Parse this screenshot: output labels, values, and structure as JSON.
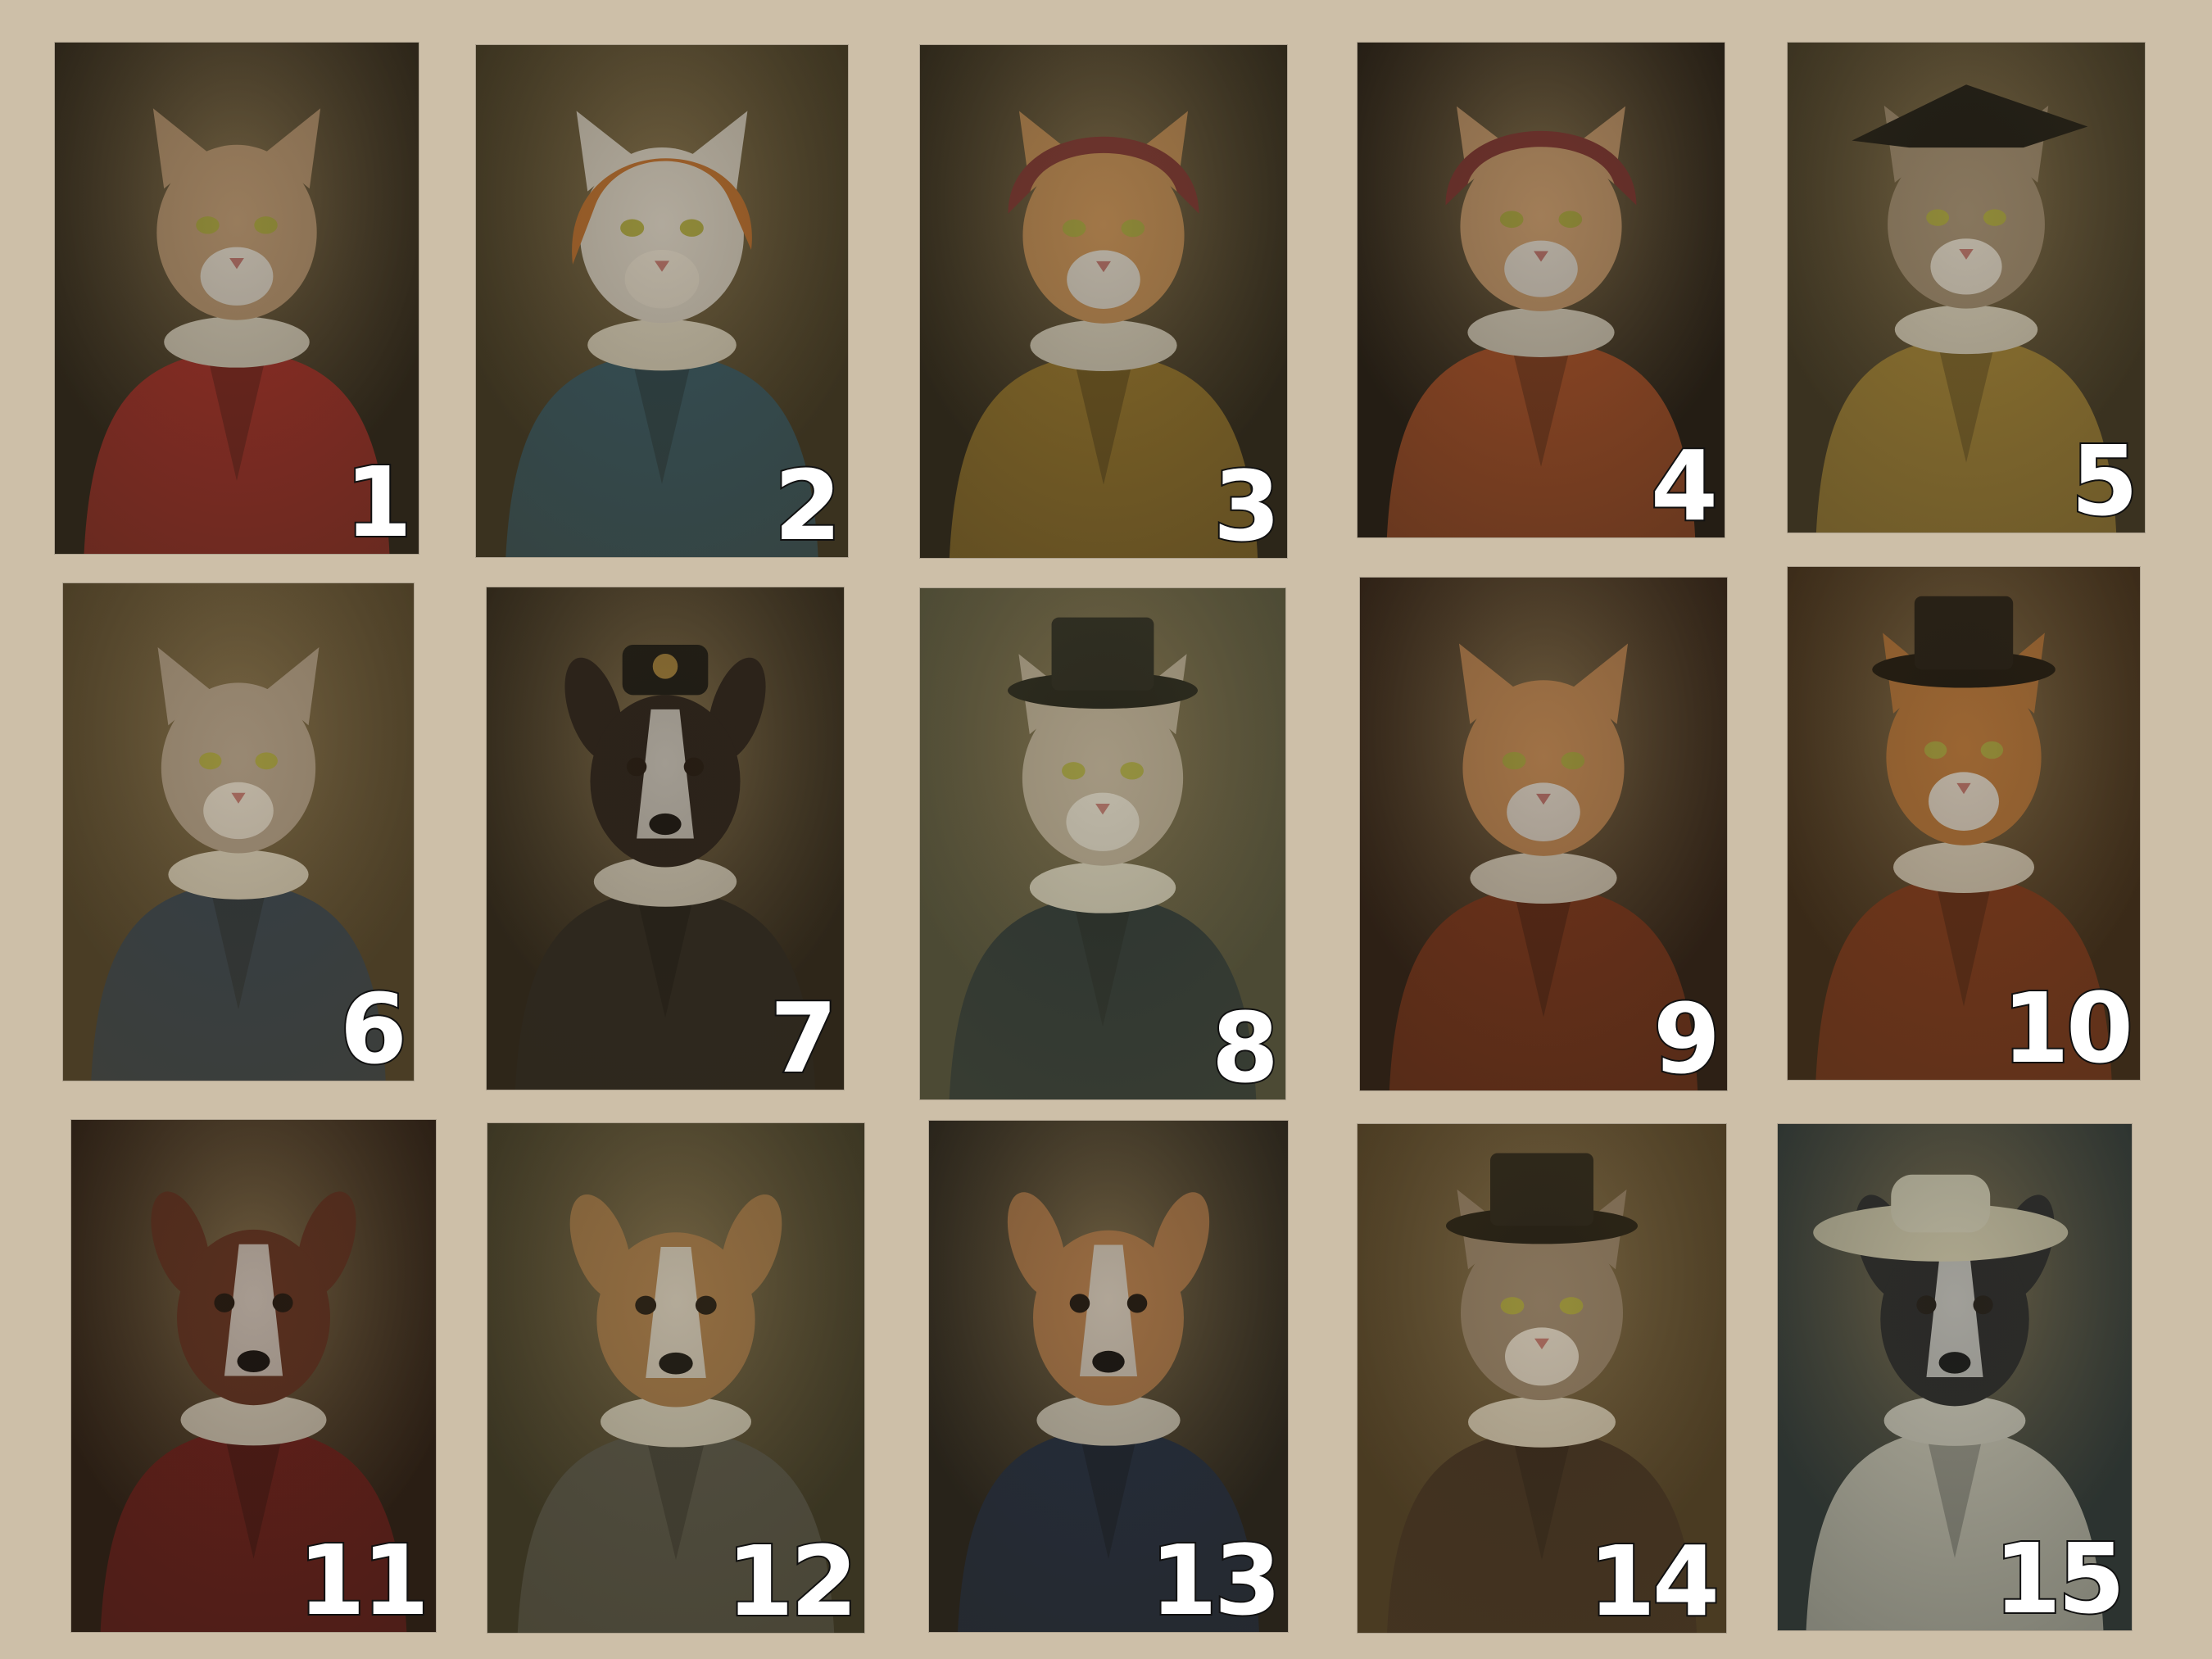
{
  "portraits": [
    {
      "number": "1",
      "animal": "cat",
      "hat": "none",
      "outfit": "#b8302a",
      "fur": "#c7a27a",
      "bg": "#2b2418"
    },
    {
      "number": "2",
      "animal": "cat",
      "hat": "headscarf",
      "outfit": "#2f5a6e",
      "fur": "#e4ddd2",
      "bg": "#3a321f"
    },
    {
      "number": "3",
      "animal": "cat",
      "hat": "bonnet",
      "outfit": "#a7822e",
      "fur": "#d49a5c",
      "bg": "#2c2619"
    },
    {
      "number": "4",
      "animal": "cat",
      "hat": "bonnet",
      "outfit": "#c05a2c",
      "fur": "#d7a775",
      "bg": "#241d14"
    },
    {
      "number": "5",
      "animal": "cat",
      "hat": "tricorn",
      "outfit": "#b08d36",
      "fur": "#a99478",
      "bg": "#3a3220"
    },
    {
      "number": "6",
      "animal": "cat",
      "hat": "none",
      "outfit": "#2a3f55",
      "fur": "#bba994",
      "bg": "#4a3d25"
    },
    {
      "number": "7",
      "animal": "dog",
      "hat": "cap",
      "outfit": "#2e2a22",
      "fur": "#2a211b",
      "bg": "#2e2619"
    },
    {
      "number": "8",
      "animal": "cat",
      "hat": "tophat",
      "outfit": "#1e2b30",
      "fur": "#c9b9a2",
      "bg": "#4c4a34"
    },
    {
      "number": "9",
      "animal": "cat",
      "hat": "none",
      "outfit": "#8a3a1c",
      "fur": "#d1955b",
      "bg": "#2d2015"
    },
    {
      "number": "10",
      "animal": "cat",
      "hat": "tophat",
      "outfit": "#8d3b1c",
      "fur": "#c47f3e",
      "bg": "#3a2a18"
    },
    {
      "number": "11",
      "animal": "dog",
      "hat": "none",
      "outfit": "#7a1f1c",
      "fur": "#6b3623",
      "bg": "#2a1e14"
    },
    {
      "number": "12",
      "animal": "dog",
      "hat": "none",
      "outfit": "#5c5a4f",
      "fur": "#b7844e",
      "bg": "#3a3522"
    },
    {
      "number": "13",
      "animal": "dog",
      "hat": "none",
      "outfit": "#22314a",
      "fur": "#c88a52",
      "bg": "#28231a"
    },
    {
      "number": "14",
      "animal": "cat",
      "hat": "tophat",
      "outfit": "#3a2a1f",
      "fur": "#a08c74",
      "bg": "#4a3b22"
    },
    {
      "number": "15",
      "animal": "dog",
      "hat": "sunhat",
      "outfit": "#e4dcc6",
      "fur": "#2a2624",
      "bg": "#2c3330"
    }
  ]
}
